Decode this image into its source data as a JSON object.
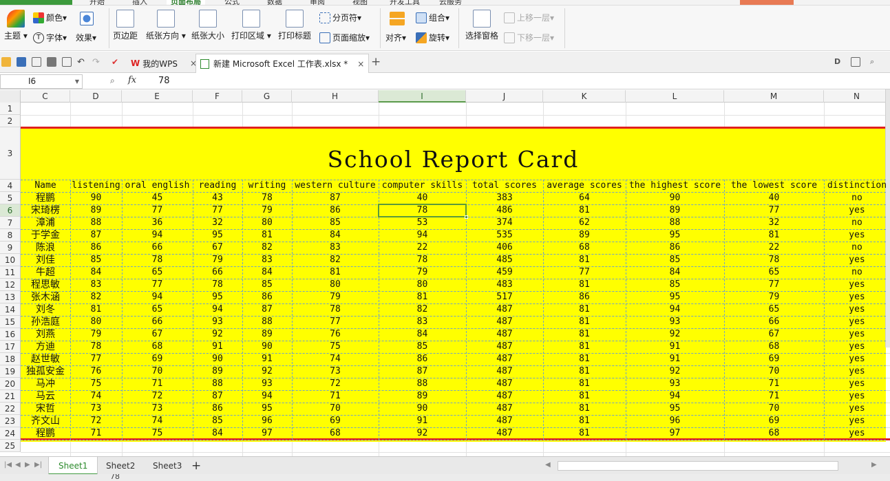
{
  "menubar": {
    "tabs": [
      "开始",
      "插入",
      "页面布局",
      "公式",
      "数据",
      "审阅",
      "视图",
      "开发工具",
      "云服务"
    ],
    "active_tab": "页面布局"
  },
  "ribbon": {
    "theme": "主题",
    "colors": "颜色",
    "font": "字体",
    "effects": "效果",
    "margins": "页边距",
    "orientation": "纸张方向",
    "size": "纸张大小",
    "print_area": "打印区域",
    "print_titles": "打印标题",
    "page_break": "分页符",
    "page_scale": "页面缩放",
    "align": "对齐",
    "group": "组合",
    "rotate": "旋转",
    "selection_pane": "选择窗格",
    "bring_forward": "上移一层",
    "send_backward": "下移一层"
  },
  "doc_tabs": {
    "home": "我的WPS",
    "file": "新建 Microsoft Excel 工作表.xlsx *",
    "close": "×",
    "add": "+"
  },
  "formula_bar": {
    "cell_ref": "I6",
    "fx": "fx",
    "value": "78"
  },
  "columns": [
    "C",
    "D",
    "E",
    "F",
    "G",
    "H",
    "I",
    "J",
    "K",
    "L",
    "M",
    "N"
  ],
  "selected_column": "I",
  "rows": [
    "1",
    "2",
    "3",
    "4",
    "5",
    "6",
    "7",
    "8",
    "9",
    "10",
    "11",
    "12",
    "13",
    "14",
    "15",
    "16",
    "17",
    "18",
    "19",
    "20",
    "21",
    "22",
    "23",
    "24",
    "25"
  ],
  "selected_row": "6",
  "report": {
    "title": "School Report Card",
    "headers": [
      "Name",
      "listening",
      "oral english",
      "reading",
      "writing",
      "western culture",
      "computer skills",
      "total scores",
      "average scores",
      "the highest score",
      "the lowest score",
      "distinction"
    ],
    "data": [
      [
        "程鹏",
        "90",
        "45",
        "43",
        "78",
        "87",
        "40",
        "383",
        "64",
        "90",
        "40",
        "no"
      ],
      [
        "宋琦楞",
        "89",
        "77",
        "77",
        "79",
        "86",
        "78",
        "486",
        "81",
        "89",
        "77",
        "yes"
      ],
      [
        "漳浦",
        "88",
        "36",
        "32",
        "80",
        "85",
        "53",
        "374",
        "62",
        "88",
        "32",
        "no"
      ],
      [
        "于学金",
        "87",
        "94",
        "95",
        "81",
        "84",
        "94",
        "535",
        "89",
        "95",
        "81",
        "yes"
      ],
      [
        "陈浪",
        "86",
        "66",
        "67",
        "82",
        "83",
        "22",
        "406",
        "68",
        "86",
        "22",
        "no"
      ],
      [
        "刘佳",
        "85",
        "78",
        "79",
        "83",
        "82",
        "78",
        "485",
        "81",
        "85",
        "78",
        "yes"
      ],
      [
        "牛超",
        "84",
        "65",
        "66",
        "84",
        "81",
        "79",
        "459",
        "77",
        "84",
        "65",
        "no"
      ],
      [
        "程思敏",
        "83",
        "77",
        "78",
        "85",
        "80",
        "80",
        "483",
        "81",
        "85",
        "77",
        "yes"
      ],
      [
        "张木涵",
        "82",
        "94",
        "95",
        "86",
        "79",
        "81",
        "517",
        "86",
        "95",
        "79",
        "yes"
      ],
      [
        "刘冬",
        "81",
        "65",
        "94",
        "87",
        "78",
        "82",
        "487",
        "81",
        "94",
        "65",
        "yes"
      ],
      [
        "孙浩庭",
        "80",
        "66",
        "93",
        "88",
        "77",
        "83",
        "487",
        "81",
        "93",
        "66",
        "yes"
      ],
      [
        "刘燕",
        "79",
        "67",
        "92",
        "89",
        "76",
        "84",
        "487",
        "81",
        "92",
        "67",
        "yes"
      ],
      [
        "方迪",
        "78",
        "68",
        "91",
        "90",
        "75",
        "85",
        "487",
        "81",
        "91",
        "68",
        "yes"
      ],
      [
        "赵世敏",
        "77",
        "69",
        "90",
        "91",
        "74",
        "86",
        "487",
        "81",
        "91",
        "69",
        "yes"
      ],
      [
        "独孤安金",
        "76",
        "70",
        "89",
        "92",
        "73",
        "87",
        "487",
        "81",
        "92",
        "70",
        "yes"
      ],
      [
        "马冲",
        "75",
        "71",
        "88",
        "93",
        "72",
        "88",
        "487",
        "81",
        "93",
        "71",
        "yes"
      ],
      [
        "马云",
        "74",
        "72",
        "87",
        "94",
        "71",
        "89",
        "487",
        "81",
        "94",
        "71",
        "yes"
      ],
      [
        "宋哲",
        "73",
        "73",
        "86",
        "95",
        "70",
        "90",
        "487",
        "81",
        "95",
        "70",
        "yes"
      ],
      [
        "齐文山",
        "72",
        "74",
        "85",
        "96",
        "69",
        "91",
        "487",
        "81",
        "96",
        "69",
        "yes"
      ],
      [
        "程鹏",
        "71",
        "75",
        "84",
        "97",
        "68",
        "92",
        "487",
        "81",
        "97",
        "68",
        "yes"
      ]
    ]
  },
  "sheets": [
    "Sheet1",
    "Sheet2",
    "Sheet3"
  ],
  "active_sheet": "Sheet1",
  "add_sheet": "+",
  "colors": {
    "report_bg": "#ffff00",
    "border_red": "#e0201e",
    "accent_green": "#3f9a3f"
  }
}
